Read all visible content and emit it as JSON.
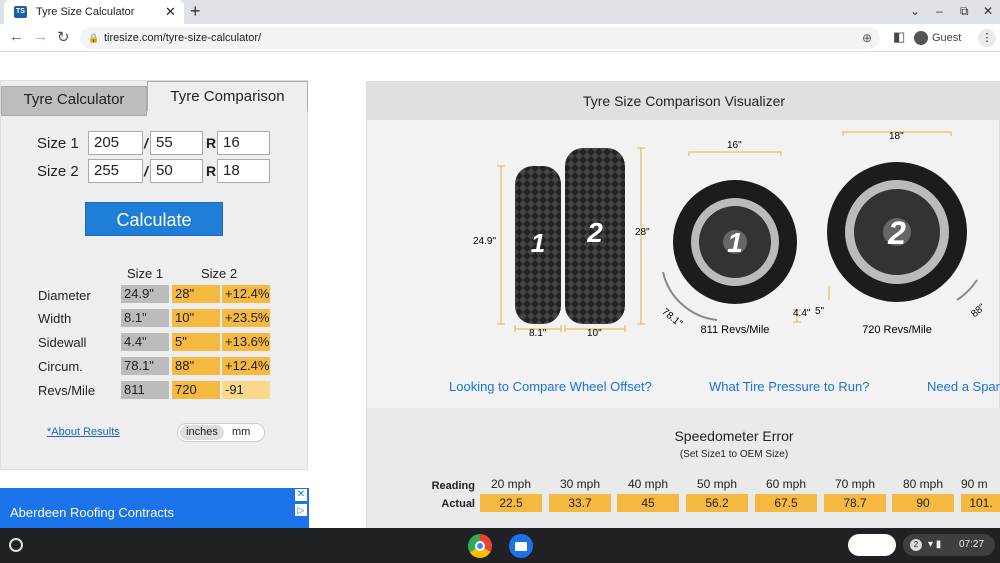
{
  "browser": {
    "tab_title": "Tyre Size Calculator",
    "favicon": "TS",
    "url": "tiresize.com/tyre-size-calculator/",
    "profile": "Guest"
  },
  "calc": {
    "tabs": [
      "Tyre Calculator",
      "Tyre Comparison"
    ],
    "size1": {
      "label": "Size 1",
      "width": "205",
      "aspect": "55",
      "rim": "16"
    },
    "size2": {
      "label": "Size 2",
      "width": "255",
      "aspect": "50",
      "rim": "18"
    },
    "sep_slash": "/",
    "sep_r": "R",
    "button": "Calculate",
    "col_size1": "Size 1",
    "col_size2": "Size 2",
    "rows": [
      {
        "label": "Diameter",
        "s1": "24.9\"",
        "s2": "28\"",
        "diff": "+12.4%"
      },
      {
        "label": "Width",
        "s1": "8.1\"",
        "s2": "10\"",
        "diff": "+23.5%"
      },
      {
        "label": "Sidewall",
        "s1": "4.4\"",
        "s2": "5\"",
        "diff": "+13.6%"
      },
      {
        "label": "Circum.",
        "s1": "78.1\"",
        "s2": "88\"",
        "diff": "+12.4%"
      },
      {
        "label": "Revs/Mile",
        "s1": "811",
        "s2": "720",
        "diff": "-91"
      }
    ],
    "about": "*About Results",
    "unit_inches": "inches",
    "unit_mm": "mm"
  },
  "ad": {
    "text": "Aberdeen Roofing Contracts"
  },
  "vis": {
    "title": "Tyre Size Comparison Visualizer",
    "tire1_num": "1",
    "tire2_num": "2",
    "dia1": "24.9\"",
    "dia2": "28\"",
    "width1": "8.1\"",
    "width2": "10\"",
    "rim1": "16\"",
    "rim2": "18\"",
    "circ1": "78.1\"",
    "circ2": "88\"",
    "side1": "4.4\"",
    "side2": "5\"",
    "revs1": "811 Revs/Mile",
    "revs2": "720 Revs/Mile",
    "links": [
      "Looking to Compare Wheel Offset?",
      "What Tire Pressure to Run?",
      "Need a Spar"
    ]
  },
  "speedo": {
    "title": "Speedometer Error",
    "subtitle": "(Set Size1 to OEM Size)",
    "reading_label": "Reading",
    "actual_label": "Actual",
    "readings": [
      "20 mph",
      "30 mph",
      "40 mph",
      "50 mph",
      "60 mph",
      "70 mph",
      "80 mph",
      "90 m"
    ],
    "actuals": [
      "22.5",
      "33.7",
      "45",
      "56.2",
      "67.5",
      "78.7",
      "90",
      "101."
    ]
  },
  "taskbar": {
    "notif_count": "2",
    "time": "07:27"
  }
}
